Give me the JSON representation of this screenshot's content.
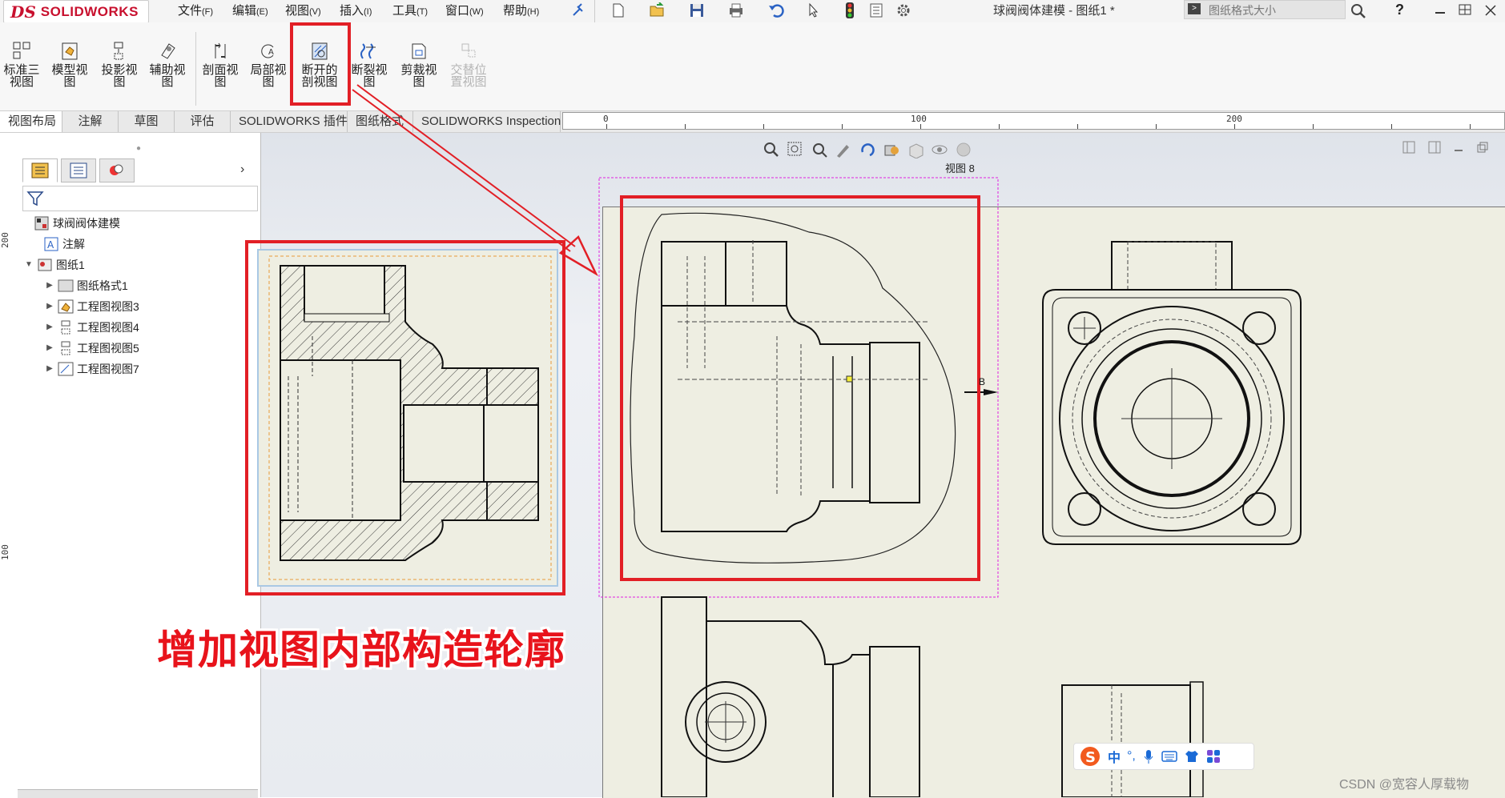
{
  "menubar": {
    "logo": "SOLIDWORKS",
    "items": [
      {
        "label": "文件",
        "key": "(F)"
      },
      {
        "label": "编辑",
        "key": "(E)"
      },
      {
        "label": "视图",
        "key": "(V)"
      },
      {
        "label": "插入",
        "key": "(I)"
      },
      {
        "label": "工具",
        "key": "(T)"
      },
      {
        "label": "窗口",
        "key": "(W)"
      },
      {
        "label": "帮助",
        "key": "(H)"
      }
    ],
    "doc_title": "球阀阀体建模 - 图纸1 *",
    "search_placeholder": "图纸格式大小",
    "help": "?"
  },
  "ribbon": {
    "buttons": [
      {
        "label1": "标准三",
        "label2": "视图",
        "icon": "standard-3-view-icon"
      },
      {
        "label1": "模型视",
        "label2": "图",
        "icon": "model-view-icon"
      },
      {
        "label1": "投影视",
        "label2": "图",
        "icon": "projected-view-icon"
      },
      {
        "label1": "辅助视",
        "label2": "图",
        "icon": "auxiliary-view-icon"
      },
      {
        "label1": "剖面视",
        "label2": "图",
        "icon": "section-view-icon"
      },
      {
        "label1": "局部视",
        "label2": "图",
        "icon": "detail-view-icon"
      },
      {
        "label1": "断开的",
        "label2": "剖视图",
        "icon": "broken-out-section-icon"
      },
      {
        "label1": "断裂视",
        "label2": "图",
        "icon": "break-view-icon"
      },
      {
        "label1": "剪裁视",
        "label2": "图",
        "icon": "crop-view-icon"
      },
      {
        "label1": "交替位",
        "label2": "置视图",
        "icon": "alternate-position-view-icon"
      }
    ]
  },
  "cmdtabs": [
    "视图布局",
    "注解",
    "草图",
    "评估",
    "SOLIDWORKS 插件",
    "图纸格式",
    "SOLIDWORKS Inspection"
  ],
  "ruler": {
    "h_labels": [
      "0",
      "100",
      "200"
    ],
    "v_labels": [
      "200",
      "100"
    ]
  },
  "tree": {
    "root": "球阀阀体建模",
    "annotations": "注解",
    "sheet": "图纸1",
    "children": [
      "图纸格式1",
      "工程图视图3",
      "工程图视图4",
      "工程图视图5",
      "工程图视图7"
    ]
  },
  "graphics": {
    "view_label": "视图 8",
    "annotation": "增加视图内部构造轮廓",
    "section_mark": "B"
  },
  "ime": {
    "lang": "中",
    "punct": "°,"
  },
  "watermark": "CSDN @宽容人厚载物",
  "colors": {
    "annotation_red": "#e21f26",
    "selection_magenta": "#e020e0",
    "brand_red": "#c8102e"
  }
}
